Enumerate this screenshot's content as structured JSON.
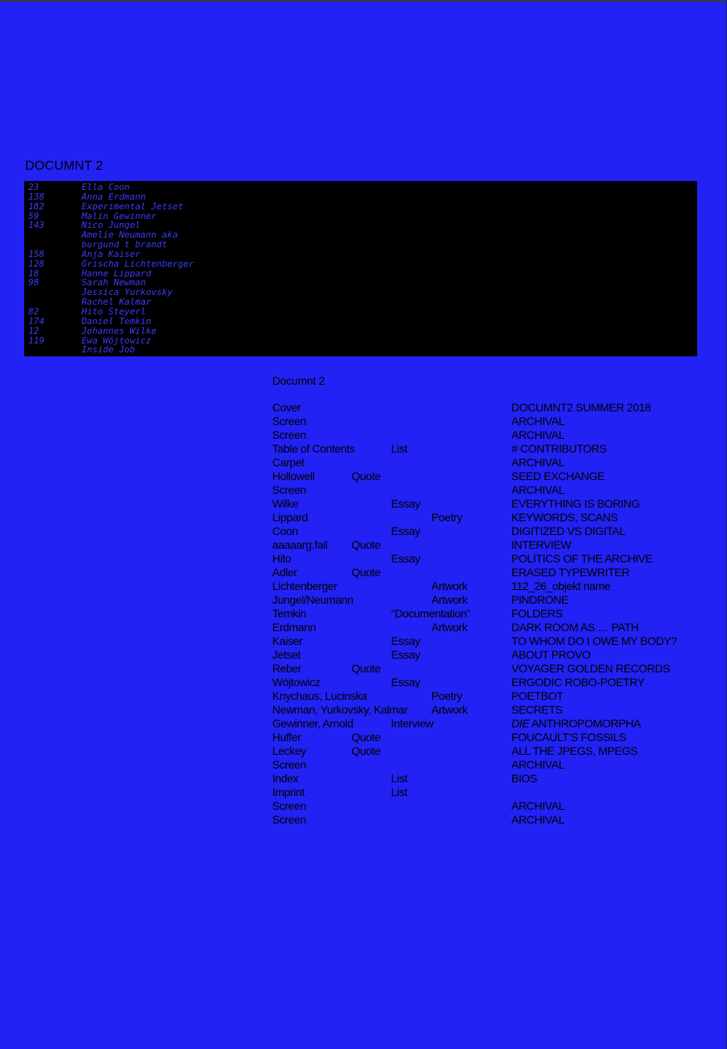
{
  "document_title": "DOCUMNT 2",
  "contributors": [
    {
      "page": "23",
      "name": "Ella Coon"
    },
    {
      "page": "138",
      "name": "Anna Erdmann"
    },
    {
      "page": "182",
      "name": "Experimental Jetset"
    },
    {
      "page": "59",
      "name": "Malin Gewinner"
    },
    {
      "page": "143",
      "name": "Nico Jungel"
    },
    {
      "page": "",
      "name": "Amelie Neumann aka"
    },
    {
      "page": "",
      "name": "burgund t brandt"
    },
    {
      "page": "158",
      "name": "Anja Kaiser"
    },
    {
      "page": "128",
      "name": "Grischa Lichtenberger"
    },
    {
      "page": "18",
      "name": "Hanne Lippard"
    },
    {
      "page": "98",
      "name": "Sarah Newman"
    },
    {
      "page": "",
      "name": "Jessica Yurkovsky"
    },
    {
      "page": "",
      "name": "Rachel Kalmar"
    },
    {
      "page": "82",
      "name": "Hito Steyerl"
    },
    {
      "page": "174",
      "name": "Daniel Temkin"
    },
    {
      "page": "12",
      "name": "Johannes Wilke"
    },
    {
      "page": "119",
      "name": "Ewa Wójtowicz"
    },
    {
      "page": "",
      "name": "Inside Job"
    }
  ],
  "toc_heading": "Documnt 2",
  "toc": [
    {
      "name": "Cover",
      "quote": "",
      "mid": "",
      "right": "",
      "title": "DOCUMNT2    SUMMER 2018",
      "title_italic": ""
    },
    {
      "name": "Screen",
      "quote": "",
      "mid": "",
      "right": "",
      "title": "ARCHIVAL",
      "title_italic": ""
    },
    {
      "name": "Screen",
      "quote": "",
      "mid": "",
      "right": "",
      "title": "ARCHIVAL",
      "title_italic": ""
    },
    {
      "name": "Table of Contents",
      "quote": "",
      "mid": "List",
      "right": "",
      "title": "# CONTRIBUTORS",
      "title_italic": ""
    },
    {
      "name": "Carpet",
      "quote": "",
      "mid": "",
      "right": "",
      "title": "ARCHIVAL",
      "title_italic": ""
    },
    {
      "name": "Hollowell",
      "quote": "Quote",
      "mid": "",
      "right": "",
      "title": "SEED EXCHANGE",
      "title_italic": ""
    },
    {
      "name": "Screen",
      "quote": "",
      "mid": "",
      "right": "",
      "title": "ARCHIVAL",
      "title_italic": ""
    },
    {
      "name": "Wilke",
      "quote": "",
      "mid": "Essay",
      "right": "",
      "title": "EVERYTHING IS BORING",
      "title_italic": ""
    },
    {
      "name": "Lippard",
      "quote": "",
      "mid": "",
      "right": "Poetry",
      "title": "KEYWORDS, SCANS",
      "title_italic": ""
    },
    {
      "name": "Coon",
      "quote": "",
      "mid": "Essay",
      "right": "",
      "title": "DIGITIZED VS DIGITAL",
      "title_italic": ""
    },
    {
      "name": "aaaaarg.fail",
      "quote": "Quote",
      "mid": "",
      "right": "",
      "title": "INTERVIEW",
      "title_italic": ""
    },
    {
      "name": "Hito",
      "quote": "",
      "mid": "Essay",
      "right": "",
      "title": "POLITICS OF THE ARCHIVE",
      "title_italic": ""
    },
    {
      "name": "Adler",
      "quote": "Quote",
      "mid": "",
      "right": "",
      "title": "ERASED TYPEWRITER",
      "title_italic": ""
    },
    {
      "name": "Lichtenberger",
      "quote": "",
      "mid": "",
      "right": "Artwork",
      "title": "112_26_objekt name",
      "title_italic": ""
    },
    {
      "name": "Jungel/Neumann",
      "quote": "",
      "mid": "",
      "right": "Artwork",
      "title": "PINDRONE",
      "title_italic": ""
    },
    {
      "name": "Temkin",
      "quote": "",
      "mid": "\"Documentation\"",
      "right": "",
      "title": "FOLDERS",
      "title_italic": ""
    },
    {
      "name": "Erdmann",
      "quote": "",
      "mid": "",
      "right": "Artwork",
      "title": "DARK ROOM AS … PATH",
      "title_italic": ""
    },
    {
      "name": "Kaiser",
      "quote": "",
      "mid": "Essay",
      "right": "",
      "title": "TO WHOM DO I OWE MY BODY?",
      "title_italic": ""
    },
    {
      "name": "Jetset",
      "quote": "",
      "mid": "Essay",
      "right": "",
      "title": "ABOUT PROVO",
      "title_italic": ""
    },
    {
      "name": "Reber",
      "quote": "Quote",
      "mid": "",
      "right": "",
      "title": "VOYAGER GOLDEN RECORDS",
      "title_italic": ""
    },
    {
      "name": "Wójtowicz",
      "quote": "",
      "mid": "Essay",
      "right": "",
      "title": "ERGODIC ROBO-POETRY",
      "title_italic": ""
    },
    {
      "name": "Knychaus, Lucinska",
      "quote": "",
      "mid": "",
      "right": "Poetry",
      "title": "POETBOT",
      "title_italic": ""
    },
    {
      "name": "Newman, Yurkovsky, Kalmar",
      "quote": "",
      "mid": "",
      "right": "Artwork",
      "title": "SECRETS",
      "title_italic": ""
    },
    {
      "name": "Gewinner, Arnold",
      "quote": "",
      "mid": "Interview",
      "right": "",
      "title": " ANTHROPOMORPHA",
      "title_italic": "DIE"
    },
    {
      "name": "Huffer",
      "quote": "Quote",
      "mid": "",
      "right": "",
      "title": "FOUCAULT'S FOSSILS",
      "title_italic": ""
    },
    {
      "name": "Leckey",
      "quote": "Quote",
      "mid": "",
      "right": "",
      "title": "ALL THE JPEGS, MPEGS",
      "title_italic": ""
    },
    {
      "name": "Screen",
      "quote": "",
      "mid": "",
      "right": "",
      "title": "ARCHIVAL",
      "title_italic": ""
    },
    {
      "name": "Index",
      "quote": "",
      "mid": "List",
      "right": "",
      "title": "BIOS",
      "title_italic": ""
    },
    {
      "name": "Imprint",
      "quote": "",
      "mid": "List",
      "right": "",
      "title": "",
      "title_italic": ""
    },
    {
      "name": "Screen",
      "quote": "",
      "mid": "",
      "right": "",
      "title": "ARCHIVAL",
      "title_italic": ""
    },
    {
      "name": "Screen",
      "quote": "",
      "mid": "",
      "right": "",
      "title": "ARCHIVAL",
      "title_italic": ""
    }
  ],
  "colors": {
    "background": "#2222f5",
    "contrib_box": "#000000",
    "contrib_text": "#3b3bff",
    "text": "#000000"
  }
}
